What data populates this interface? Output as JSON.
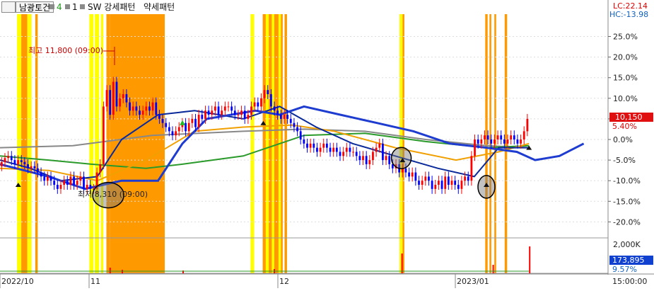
{
  "toolbar": {
    "stock_name": "남광토건",
    "num_a": "4",
    "num_b": "1",
    "pattern_label": "SW 강세패턴",
    "weak_label": "약세패턴"
  },
  "indicators": {
    "lc": "LC:22.14",
    "hc": "HC:-13.98",
    "current_price": "10,150",
    "current_change": "5.40%",
    "volume_value": "173,895",
    "volume_pct": "9.57%"
  },
  "annotations": {
    "high": "최고 11,800 (09:00)",
    "low": "최저 8,310 (09:00)"
  },
  "colors": {
    "yellow_band": "#ffff00",
    "orange_band": "#ff9900",
    "candle_up": "#ff0000",
    "candle_down": "#0000ff",
    "ma_darkblue": "#0a2a9a",
    "ma_blue": "#1e3ccf",
    "ma_orange": "#f0a000",
    "ma_green": "#2a9a2a",
    "ma_gray": "#888888",
    "price_box": "#e01010",
    "volume_box": "#1040d0"
  },
  "chart_data": {
    "type": "candlestick",
    "y_axis": "percent change",
    "ylim": [
      -23,
      30
    ],
    "yticks": [
      "25.0%",
      "20.0%",
      "15.0%",
      "10.0%",
      "5.0%",
      "0.0%",
      "-5.0%",
      "-10.0%",
      "-15.0%",
      "-20.0%"
    ],
    "ytick_values": [
      25,
      20,
      15,
      10,
      5,
      0,
      -5,
      -10,
      -15,
      -20
    ],
    "volume_ticks": [
      "2,000K"
    ],
    "xticks": [
      "2022/10",
      "11",
      "12",
      "2023/01"
    ],
    "time_label": "15:00:00",
    "closes": [
      -5.5,
      -4.5,
      -4,
      -5,
      -6,
      -5,
      -5.5,
      -6,
      -7,
      -6.5,
      -7,
      -8,
      -9,
      -10,
      -9,
      -10,
      -11,
      -12,
      -11,
      -10,
      -11,
      -9,
      -11,
      -10,
      -9,
      -12,
      -11,
      -12,
      -12,
      -8,
      -6,
      8,
      12,
      6,
      14,
      8,
      10,
      11,
      9,
      7,
      8,
      7,
      6,
      7,
      8,
      7,
      9,
      6,
      5,
      4,
      3,
      2,
      1,
      2,
      3,
      4,
      2,
      4,
      5,
      3,
      6,
      5,
      7,
      6,
      7,
      8,
      6,
      7,
      8,
      8,
      7,
      6,
      6,
      7,
      5,
      6,
      8,
      9,
      8,
      10,
      12,
      11,
      8,
      7,
      6,
      5,
      6,
      5,
      4,
      3,
      2,
      0,
      -1,
      -2,
      -1,
      -2,
      -3,
      -2,
      -1,
      -2,
      -3,
      -2,
      -3,
      -4,
      -3,
      -2,
      -3,
      -3,
      -4,
      -5,
      -4,
      -6,
      -5,
      -3,
      -2,
      -1,
      -5,
      -4,
      -6,
      -7,
      -6,
      -8,
      -7,
      -8,
      -9,
      -8,
      -10,
      -11,
      -10,
      -9,
      -10,
      -12,
      -11,
      -10,
      -12,
      -9,
      -11,
      -10,
      -11,
      -12,
      -10,
      -9,
      -10,
      -4,
      0,
      -1,
      0,
      1,
      0,
      -1,
      0,
      1,
      0,
      -1,
      0,
      1,
      0,
      -1,
      0,
      2,
      5
    ],
    "max_high": {
      "index": 31,
      "value": 11800
    },
    "min_low": {
      "index": 28,
      "value": 8310
    }
  }
}
